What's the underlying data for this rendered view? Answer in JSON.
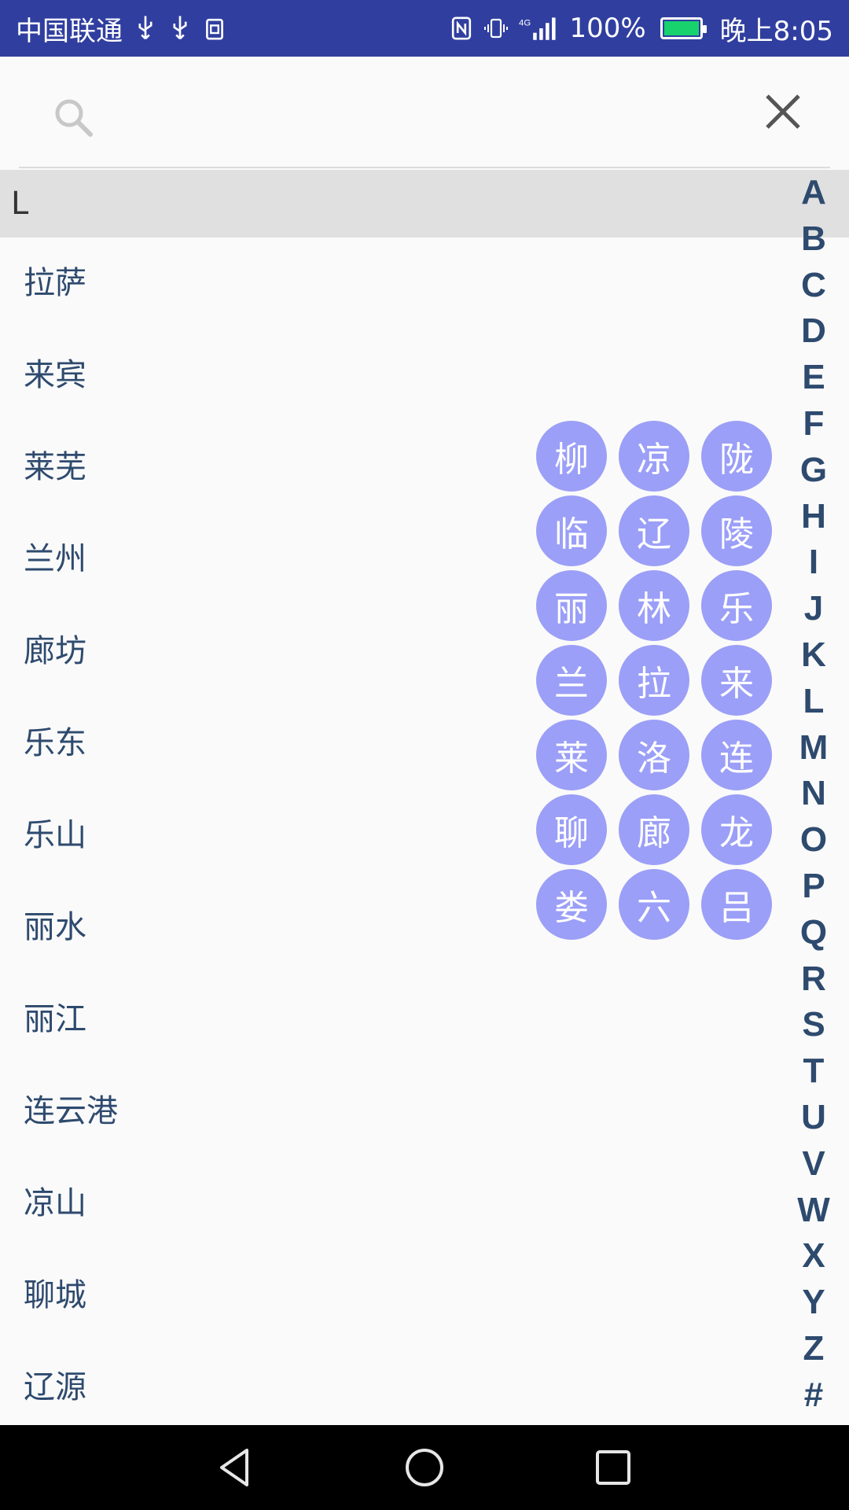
{
  "status_bar": {
    "carrier": "中国联通",
    "battery": "100%",
    "time": "晚上8:05",
    "icons": [
      "usb-icon",
      "usb-icon",
      "sim-icon",
      "nfc-icon",
      "vibrate-icon",
      "signal-icon",
      "battery-icon"
    ]
  },
  "search": {
    "placeholder": "",
    "value": ""
  },
  "section": {
    "header": "L"
  },
  "cities": [
    "拉萨",
    "来宾",
    "莱芜",
    "兰州",
    "廊坊",
    "乐东",
    "乐山",
    "丽水",
    "丽江",
    "连云港",
    "凉山",
    "聊城",
    "辽源"
  ],
  "index_letters": [
    "A",
    "B",
    "C",
    "D",
    "E",
    "F",
    "G",
    "H",
    "I",
    "J",
    "K",
    "L",
    "M",
    "N",
    "O",
    "P",
    "Q",
    "R",
    "S",
    "T",
    "U",
    "V",
    "W",
    "X",
    "Y",
    "Z",
    "#"
  ],
  "char_grid": [
    "柳",
    "凉",
    "陇",
    "临",
    "辽",
    "陵",
    "丽",
    "林",
    "乐",
    "兰",
    "拉",
    "来",
    "莱",
    "洛",
    "连",
    "聊",
    "廊",
    "龙",
    "娄",
    "六",
    "吕"
  ],
  "colors": {
    "status_bar": "#303f9f",
    "city_text": "#2e4a6e",
    "char_circle": "#9b9ff7",
    "section_header_bg": "#e0e0e0"
  }
}
